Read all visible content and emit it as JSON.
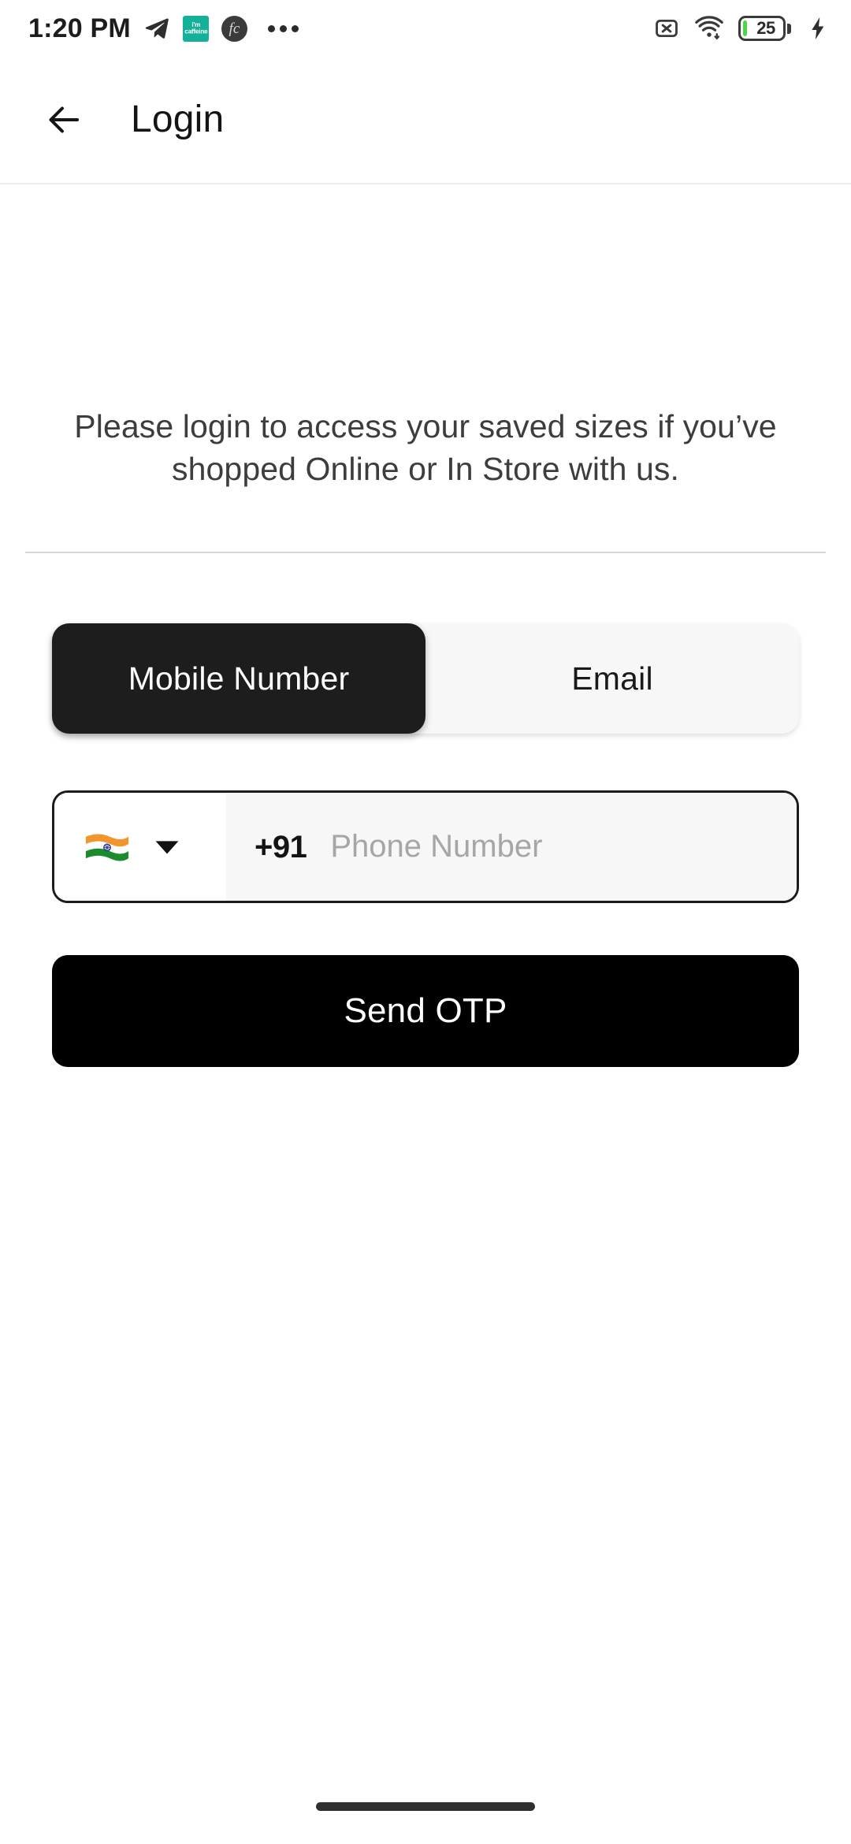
{
  "status_bar": {
    "time": "1:20 PM",
    "left_icons": [
      {
        "name": "telegram-icon",
        "label": "Telegram"
      },
      {
        "name": "caffeine-app-icon",
        "label": "i'm caffeine",
        "color": "#13b199",
        "line1": "i'm",
        "line2": "caffeine"
      },
      {
        "name": "fc-app-icon",
        "label": "fc",
        "glyph": "fc"
      },
      {
        "name": "more-notifications-icon",
        "label": "More notifications"
      }
    ],
    "right_icons": [
      {
        "name": "sim-card-missing-icon",
        "label": "No SIM"
      },
      {
        "name": "wifi-icon",
        "label": "Wi-Fi connected"
      }
    ],
    "battery": {
      "percent_text": "25",
      "percent_value": 25,
      "fill_color": "#4ad74a",
      "charging": true,
      "charging_icon_name": "charging-bolt-icon"
    }
  },
  "app_bar": {
    "back_icon_name": "back-arrow-icon",
    "title": "Login"
  },
  "main": {
    "intro_text": "Please login to access your saved sizes if you’ve shopped Online or In Store with us.",
    "tabs": [
      {
        "label": "Mobile Number",
        "active": true
      },
      {
        "label": "Email",
        "active": false
      }
    ],
    "phone_field": {
      "country_flag": "India",
      "country_code": "+91",
      "placeholder": "Phone Number",
      "value": "",
      "dropdown_icon_name": "chevron-down-icon"
    },
    "primary_button": {
      "label": "Send OTP",
      "background": "#000000",
      "text_color": "#ffffff"
    }
  },
  "nav_bar": {
    "home_indicator_label": "Home gesture bar"
  },
  "theme": {
    "accent_dark": "#1d1d1d",
    "page_background": "#ffffff",
    "muted_text": "#3d3d3d",
    "placeholder_text": "#a6a6a6",
    "field_fill": "#f7f7f7",
    "divider": "#d6d6d6"
  }
}
